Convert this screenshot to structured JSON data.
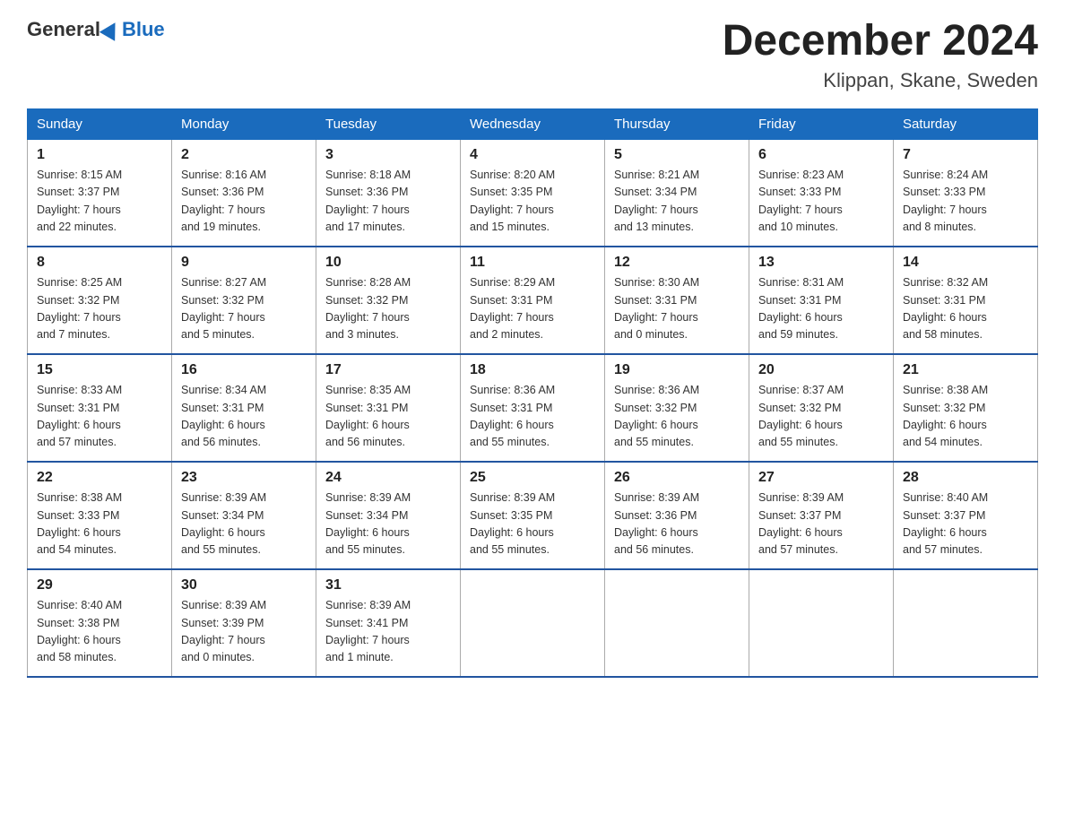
{
  "logo": {
    "general": "General",
    "blue": "Blue"
  },
  "title": "December 2024",
  "subtitle": "Klippan, Skane, Sweden",
  "days_of_week": [
    "Sunday",
    "Monday",
    "Tuesday",
    "Wednesday",
    "Thursday",
    "Friday",
    "Saturday"
  ],
  "weeks": [
    [
      {
        "num": "1",
        "info": "Sunrise: 8:15 AM\nSunset: 3:37 PM\nDaylight: 7 hours\nand 22 minutes."
      },
      {
        "num": "2",
        "info": "Sunrise: 8:16 AM\nSunset: 3:36 PM\nDaylight: 7 hours\nand 19 minutes."
      },
      {
        "num": "3",
        "info": "Sunrise: 8:18 AM\nSunset: 3:36 PM\nDaylight: 7 hours\nand 17 minutes."
      },
      {
        "num": "4",
        "info": "Sunrise: 8:20 AM\nSunset: 3:35 PM\nDaylight: 7 hours\nand 15 minutes."
      },
      {
        "num": "5",
        "info": "Sunrise: 8:21 AM\nSunset: 3:34 PM\nDaylight: 7 hours\nand 13 minutes."
      },
      {
        "num": "6",
        "info": "Sunrise: 8:23 AM\nSunset: 3:33 PM\nDaylight: 7 hours\nand 10 minutes."
      },
      {
        "num": "7",
        "info": "Sunrise: 8:24 AM\nSunset: 3:33 PM\nDaylight: 7 hours\nand 8 minutes."
      }
    ],
    [
      {
        "num": "8",
        "info": "Sunrise: 8:25 AM\nSunset: 3:32 PM\nDaylight: 7 hours\nand 7 minutes."
      },
      {
        "num": "9",
        "info": "Sunrise: 8:27 AM\nSunset: 3:32 PM\nDaylight: 7 hours\nand 5 minutes."
      },
      {
        "num": "10",
        "info": "Sunrise: 8:28 AM\nSunset: 3:32 PM\nDaylight: 7 hours\nand 3 minutes."
      },
      {
        "num": "11",
        "info": "Sunrise: 8:29 AM\nSunset: 3:31 PM\nDaylight: 7 hours\nand 2 minutes."
      },
      {
        "num": "12",
        "info": "Sunrise: 8:30 AM\nSunset: 3:31 PM\nDaylight: 7 hours\nand 0 minutes."
      },
      {
        "num": "13",
        "info": "Sunrise: 8:31 AM\nSunset: 3:31 PM\nDaylight: 6 hours\nand 59 minutes."
      },
      {
        "num": "14",
        "info": "Sunrise: 8:32 AM\nSunset: 3:31 PM\nDaylight: 6 hours\nand 58 minutes."
      }
    ],
    [
      {
        "num": "15",
        "info": "Sunrise: 8:33 AM\nSunset: 3:31 PM\nDaylight: 6 hours\nand 57 minutes."
      },
      {
        "num": "16",
        "info": "Sunrise: 8:34 AM\nSunset: 3:31 PM\nDaylight: 6 hours\nand 56 minutes."
      },
      {
        "num": "17",
        "info": "Sunrise: 8:35 AM\nSunset: 3:31 PM\nDaylight: 6 hours\nand 56 minutes."
      },
      {
        "num": "18",
        "info": "Sunrise: 8:36 AM\nSunset: 3:31 PM\nDaylight: 6 hours\nand 55 minutes."
      },
      {
        "num": "19",
        "info": "Sunrise: 8:36 AM\nSunset: 3:32 PM\nDaylight: 6 hours\nand 55 minutes."
      },
      {
        "num": "20",
        "info": "Sunrise: 8:37 AM\nSunset: 3:32 PM\nDaylight: 6 hours\nand 55 minutes."
      },
      {
        "num": "21",
        "info": "Sunrise: 8:38 AM\nSunset: 3:32 PM\nDaylight: 6 hours\nand 54 minutes."
      }
    ],
    [
      {
        "num": "22",
        "info": "Sunrise: 8:38 AM\nSunset: 3:33 PM\nDaylight: 6 hours\nand 54 minutes."
      },
      {
        "num": "23",
        "info": "Sunrise: 8:39 AM\nSunset: 3:34 PM\nDaylight: 6 hours\nand 55 minutes."
      },
      {
        "num": "24",
        "info": "Sunrise: 8:39 AM\nSunset: 3:34 PM\nDaylight: 6 hours\nand 55 minutes."
      },
      {
        "num": "25",
        "info": "Sunrise: 8:39 AM\nSunset: 3:35 PM\nDaylight: 6 hours\nand 55 minutes."
      },
      {
        "num": "26",
        "info": "Sunrise: 8:39 AM\nSunset: 3:36 PM\nDaylight: 6 hours\nand 56 minutes."
      },
      {
        "num": "27",
        "info": "Sunrise: 8:39 AM\nSunset: 3:37 PM\nDaylight: 6 hours\nand 57 minutes."
      },
      {
        "num": "28",
        "info": "Sunrise: 8:40 AM\nSunset: 3:37 PM\nDaylight: 6 hours\nand 57 minutes."
      }
    ],
    [
      {
        "num": "29",
        "info": "Sunrise: 8:40 AM\nSunset: 3:38 PM\nDaylight: 6 hours\nand 58 minutes."
      },
      {
        "num": "30",
        "info": "Sunrise: 8:39 AM\nSunset: 3:39 PM\nDaylight: 7 hours\nand 0 minutes."
      },
      {
        "num": "31",
        "info": "Sunrise: 8:39 AM\nSunset: 3:41 PM\nDaylight: 7 hours\nand 1 minute."
      },
      null,
      null,
      null,
      null
    ]
  ]
}
